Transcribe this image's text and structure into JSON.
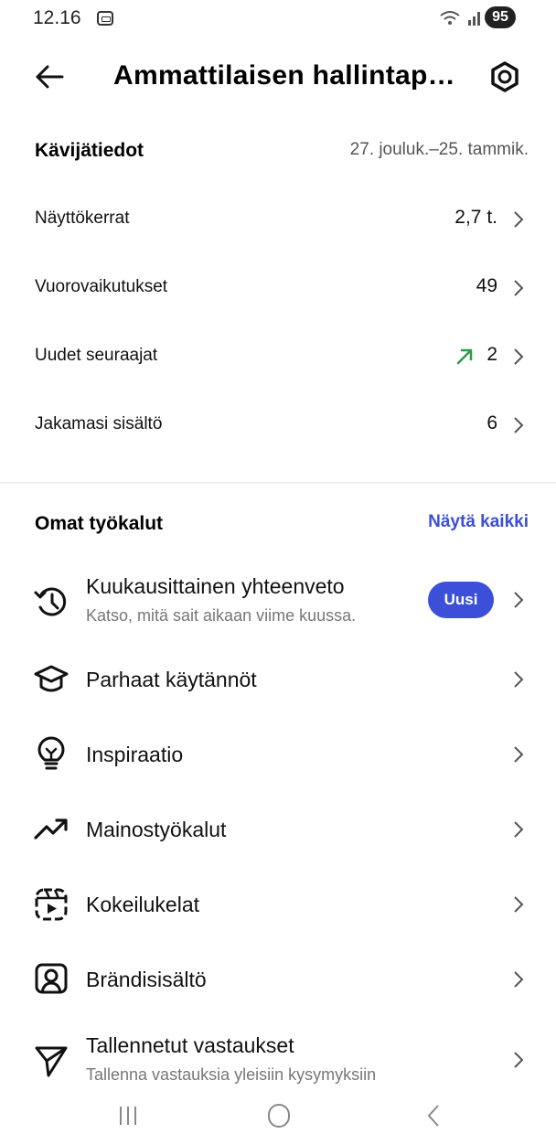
{
  "status_bar": {
    "time": "12.16",
    "battery": "95"
  },
  "header": {
    "title": "Ammattilaisen hallintap…"
  },
  "insights": {
    "title": "Kävijätiedot",
    "date_range": "27. jouluk.–25. tammik.",
    "rows": [
      {
        "label": "Näyttökerrat",
        "value": "2,7 t."
      },
      {
        "label": "Vuorovaikutukset",
        "value": "49"
      },
      {
        "label": "Uudet seuraajat",
        "value": "2",
        "trend": "up"
      },
      {
        "label": "Jakamasi sisältö",
        "value": "6"
      }
    ]
  },
  "tools": {
    "title": "Omat työkalut",
    "see_all": "Näytä kaikki",
    "items": [
      {
        "label": "Kuukausittainen yhteenveto",
        "subtitle": "Katso, mitä sait aikaan viime kuussa.",
        "badge": "Uusi",
        "icon": "history-icon"
      },
      {
        "label": "Parhaat käytännöt",
        "icon": "graduation-cap-icon"
      },
      {
        "label": "Inspiraatio",
        "icon": "lightbulb-icon"
      },
      {
        "label": "Mainostyökalut",
        "icon": "trending-up-icon"
      },
      {
        "label": "Kokeilukelat",
        "icon": "reels-icon"
      },
      {
        "label": "Brändisisältö",
        "icon": "branded-content-icon"
      },
      {
        "label": "Tallennetut vastaukset",
        "subtitle": "Tallenna vastauksia yleisiin kysymyksiin",
        "icon": "send-icon"
      }
    ]
  }
}
